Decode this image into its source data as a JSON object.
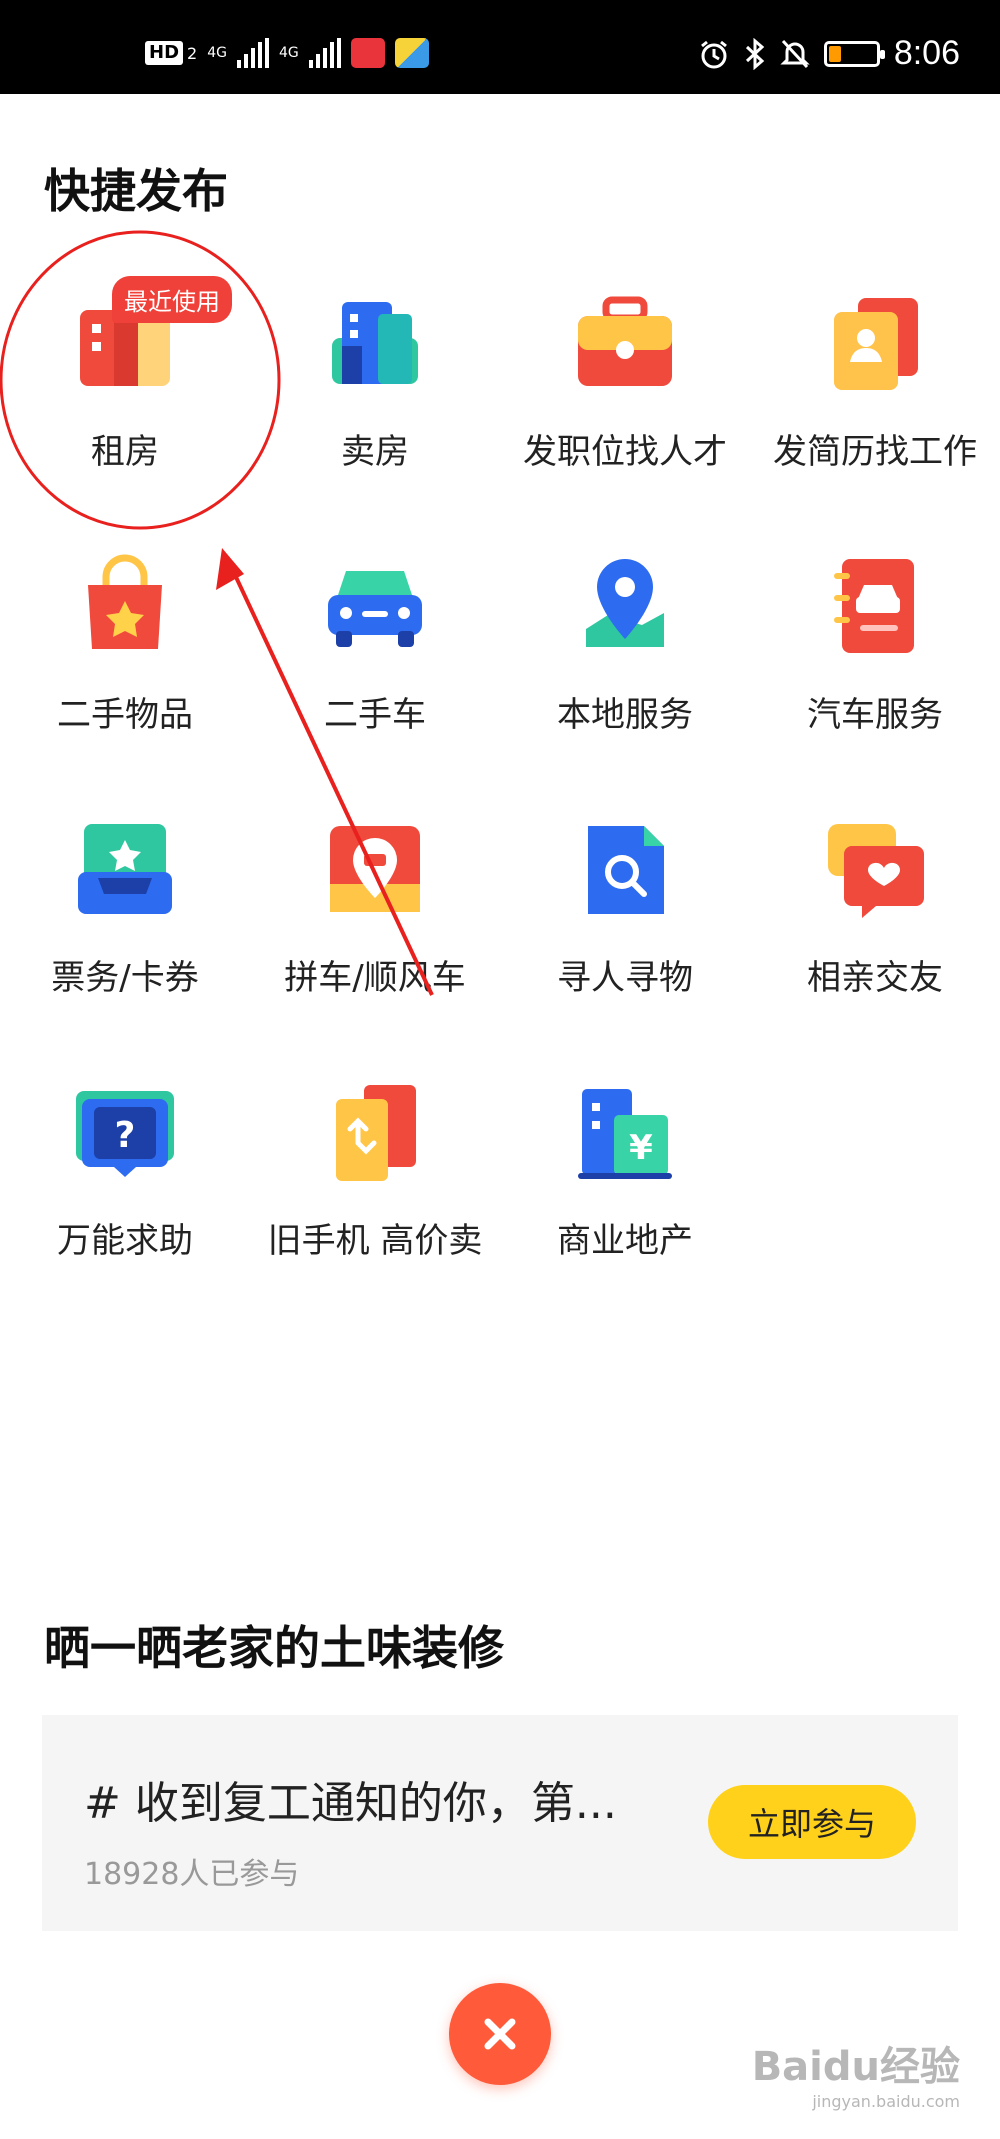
{
  "status_bar": {
    "hd": "HD",
    "hd_sub": "2",
    "net1": "4G",
    "net2": "4G",
    "time": "8:06",
    "icons": [
      "alarm-icon",
      "bluetooth-icon",
      "mute-icon",
      "battery-icon"
    ]
  },
  "quick_publish": {
    "title": "快捷发布",
    "recent_badge": "最近使用",
    "items": [
      {
        "label": "租房",
        "icon": "rent-house-icon"
      },
      {
        "label": "卖房",
        "icon": "sell-house-icon"
      },
      {
        "label": "发职位找人才",
        "icon": "briefcase-icon"
      },
      {
        "label": "发简历找工作",
        "icon": "resume-icon"
      },
      {
        "label": "二手物品",
        "icon": "shopping-bag-icon"
      },
      {
        "label": "二手车",
        "icon": "car-icon"
      },
      {
        "label": "本地服务",
        "icon": "location-pin-icon"
      },
      {
        "label": "汽车服务",
        "icon": "car-notebook-icon"
      },
      {
        "label": "票务/卡券",
        "icon": "ticket-icon"
      },
      {
        "label": "拼车/顺风车",
        "icon": "carpool-icon"
      },
      {
        "label": "寻人寻物",
        "icon": "search-document-icon"
      },
      {
        "label": "相亲交友",
        "icon": "chat-heart-icon"
      },
      {
        "label": "万能求助",
        "icon": "help-book-icon"
      },
      {
        "label": "旧手机 高价卖",
        "icon": "phone-swap-icon"
      },
      {
        "label": "商业地产",
        "icon": "commercial-building-icon"
      }
    ]
  },
  "promo": {
    "title": "晒一晒老家的土味装修",
    "topic": "# 收到复工通知的你，第...",
    "count": "18928人已参与",
    "button": "立即参与"
  },
  "watermark": {
    "main": "Baidu经验",
    "sub": "jingyan.baidu.com"
  },
  "colors": {
    "accent_yellow": "#ffd11a",
    "close_red": "#ff5a3a",
    "badge_red": "#f0403a",
    "annotation_red": "#e8211e"
  }
}
